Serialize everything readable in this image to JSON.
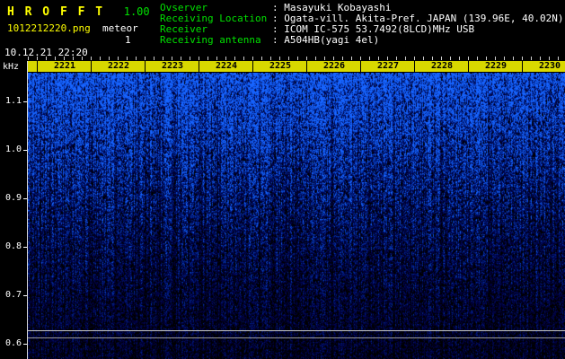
{
  "header": {
    "app_name": "H R O F F T",
    "version": "1.00",
    "filename": "1012212220.png",
    "mode_label": "meteor",
    "meteor_count": "1",
    "datetime": "10.12.21 22:20",
    "info_rows": [
      {
        "label": "Ovserver",
        "value": ": Masayuki Kobayashi"
      },
      {
        "label": "Receiving Location",
        "value": ": Ogata-vill. Akita-Pref. JAPAN (139.96E, 40.02N)"
      },
      {
        "label": "Receiver",
        "value": ": ICOM IC-575 53.7492(8LCD)MHz USB"
      },
      {
        "label": "Receiving antenna",
        "value": ": A504HB(yagi 4el)"
      }
    ]
  },
  "chart_data": {
    "type": "heatmap",
    "title": "HROFFT radio meteor observation spectrogram",
    "ylabel": "kHz",
    "x_ticks": [
      "2221",
      "2222",
      "2223",
      "2224",
      "2225",
      "2226",
      "2227",
      "2228",
      "2229",
      "2230"
    ],
    "y_ticks": [
      "1.1",
      "1.0",
      "0.9",
      "0.8",
      "0.7",
      "0.6"
    ],
    "ylim": [
      0.57,
      1.17
    ],
    "x_is_time_hhmm": true,
    "x_tick_interval_seconds": 60,
    "legend": "off",
    "grid": "off",
    "colormap": "black -> dark blue -> blue -> cyan",
    "content_summary": "Ten minutes (22:21-22:30) of broadband receiver background noise shown as vertical blue speckle; noise intensity is strongest near the top of the band (about 1.1-1.17 kHz) and gradually fades toward 0.6 kHz; two faint horizontal baseline lines appear near 0.62 kHz; no strong meteor echo trace is visible."
  },
  "colors": {
    "background": "#000000",
    "title_yellow": "#ffff00",
    "version_green": "#00e100",
    "label_green": "#00e100",
    "value_white": "#ffffff",
    "time_strip_yellow": "#d8d800",
    "time_strip_text": "#000000",
    "axis_white": "#ffffff",
    "noise_blue": "#0030c0"
  }
}
